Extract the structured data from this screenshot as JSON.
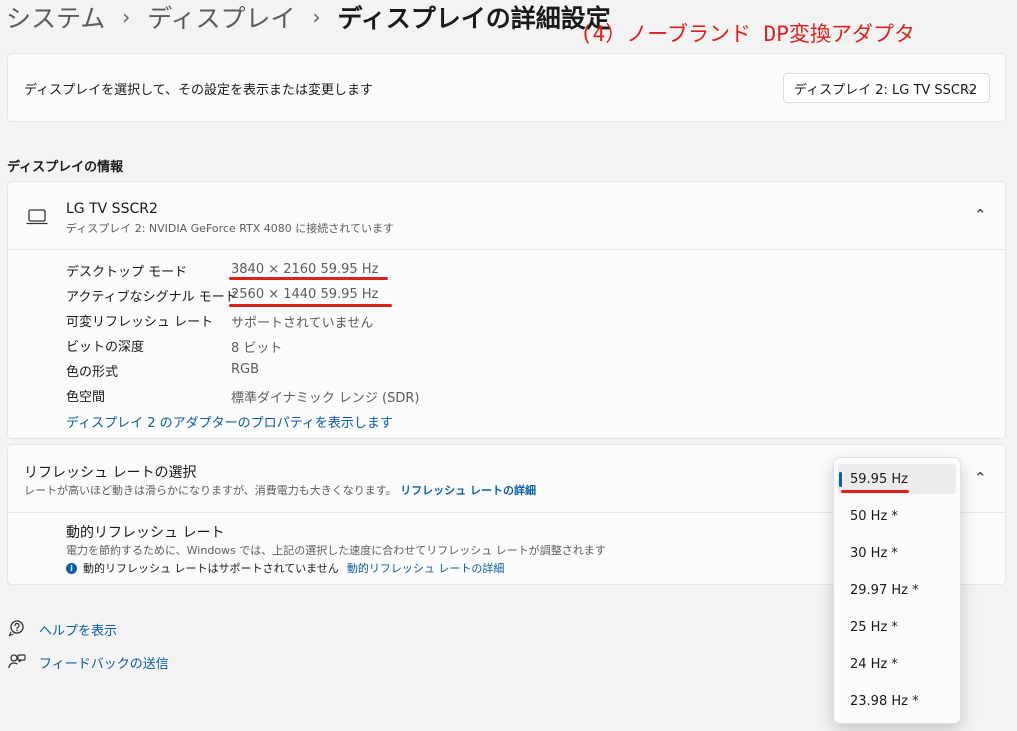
{
  "breadcrumb": {
    "items": [
      "システム",
      "ディスプレイ",
      "ディスプレイの詳細設定"
    ],
    "separator": "›"
  },
  "annotation": "(4）ノーブランド DP変換アダプタ",
  "select_display": {
    "text": "ディスプレイを選択して、その設定を表示または変更します",
    "selected": "ディスプレイ 2: LG TV SSCR2"
  },
  "info_section": {
    "title": "ディスプレイの情報",
    "device_name": "LG TV SSCR2",
    "device_subtitle": "ディスプレイ 2: NVIDIA GeForce RTX 4080 に接続されています",
    "rows": [
      {
        "label": "デスクトップ モード",
        "value": "3840 × 2160 59.95 Hz"
      },
      {
        "label": "アクティブなシグナル モード",
        "value": "2560 × 1440 59.95 Hz"
      },
      {
        "label": "可変リフレッシュ レート",
        "value": "サポートされていません"
      },
      {
        "label": "ビットの深度",
        "value": "8 ビット"
      },
      {
        "label": "色の形式",
        "value": "RGB"
      },
      {
        "label": "色空間",
        "value": "標準ダイナミック レンジ (SDR)"
      }
    ],
    "adapter_link": "ディスプレイ 2 のアダプターのプロパティを表示します"
  },
  "refresh": {
    "title": "リフレッシュ レートの選択",
    "subtitle": "レートが高いほど動きは滑らかになりますが、消費電力も大きくなります。",
    "subtitle_link": "リフレッシュ レートの詳細",
    "dynamic_title": "動的リフレッシュ レート",
    "dynamic_subtitle": "電力を節約するために、Windows では、上記の選択した速度に合わせてリフレッシュ レートが調整されます",
    "dynamic_note": "動的リフレッシュ レートはサポートされていません",
    "dynamic_link": "動的リフレッシュ レートの詳細",
    "options": [
      "59.95 Hz",
      "50 Hz *",
      "30 Hz *",
      "29.97 Hz *",
      "25 Hz *",
      "24 Hz *",
      "23.98 Hz *"
    ],
    "selected": "59.95 Hz"
  },
  "footer": {
    "help": "ヘルプを表示",
    "feedback": "フィードバックの送信"
  },
  "colors": {
    "accent": "#0a5db9",
    "link": "#0b5cad",
    "annotation": "#e0201b"
  }
}
